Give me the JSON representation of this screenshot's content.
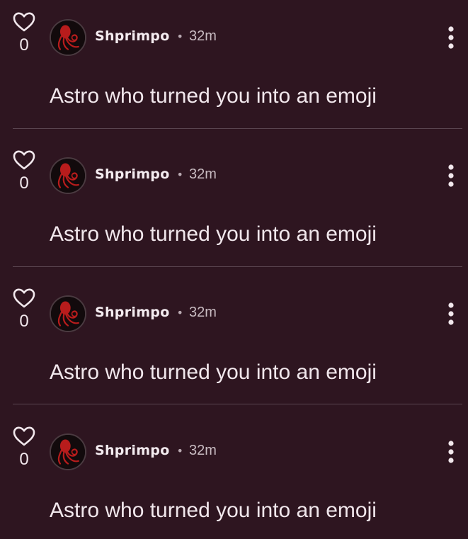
{
  "posts": [
    {
      "like_count": "0",
      "username": "Shprimpo",
      "separator": "•",
      "time": "32m",
      "text": "Astro who turned you into an emoji",
      "avatar_icon": "octopus-avatar",
      "like_icon": "heart-outline-icon",
      "menu_icon": "more-vertical-icon"
    },
    {
      "like_count": "0",
      "username": "Shprimpo",
      "separator": "•",
      "time": "32m",
      "text": "Astro who turned you into an emoji",
      "avatar_icon": "octopus-avatar",
      "like_icon": "heart-outline-icon",
      "menu_icon": "more-vertical-icon"
    },
    {
      "like_count": "0",
      "username": "Shprimpo",
      "separator": "•",
      "time": "32m",
      "text": "Astro who turned you into an emoji",
      "avatar_icon": "octopus-avatar",
      "like_icon": "heart-outline-icon",
      "menu_icon": "more-vertical-icon"
    },
    {
      "like_count": "0",
      "username": "Shprimpo",
      "separator": "•",
      "time": "32m",
      "text": "Astro who turned you into an emoji",
      "avatar_icon": "octopus-avatar",
      "like_icon": "heart-outline-icon",
      "menu_icon": "more-vertical-icon"
    }
  ],
  "colors": {
    "background": "#2e1520",
    "text": "#f1e7ec",
    "muted_text": "#c9bcc2",
    "divider": "#5a4550",
    "avatar_accent": "#b81c1c"
  }
}
